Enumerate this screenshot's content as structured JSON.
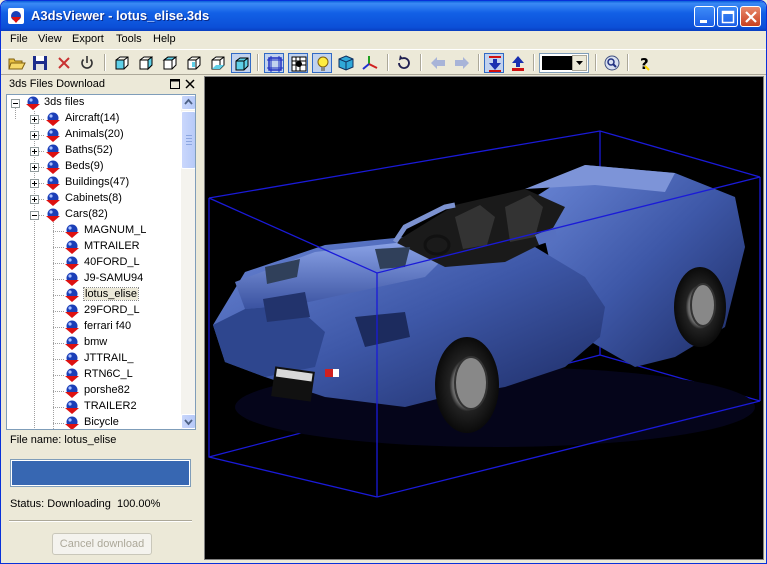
{
  "window": {
    "title": "A3dsViewer - lotus_elise.3ds"
  },
  "menu": {
    "items": [
      "File",
      "View",
      "Export",
      "Tools",
      "Help"
    ]
  },
  "toolbar": {
    "background_color_value": "#000000"
  },
  "panel": {
    "title": "3ds Files Download"
  },
  "tree": {
    "root": "3ds files",
    "categories": [
      "Aircraft(14)",
      "Animals(20)",
      "Baths(52)",
      "Beds(9)",
      "Buildings(47)",
      "Cabinets(8)",
      "Cars(82)"
    ],
    "cars": [
      "MAGNUM_L",
      "MTRAILER",
      "40FORD_L",
      "J9-SAMU94",
      "lotus_elise",
      "29FORD_L",
      "ferrari f40",
      "bmw",
      "JTTRAIL_",
      "RTN6C_L",
      "porshe82",
      "TRAILER2",
      "Bicycle"
    ],
    "selected": "lotus_elise"
  },
  "download": {
    "file_name": "File name: lotus_elise",
    "progress": 1.0,
    "status": "Status: Downloading  100.00%",
    "cancel_label": "Cancel download"
  },
  "colors": {
    "title_bar": "#0b55d8",
    "progress_fill": "#3767b2",
    "viewport_bg": "#000000",
    "bounding_box": "#1a1ad8",
    "car_body": "#4a64b0"
  }
}
